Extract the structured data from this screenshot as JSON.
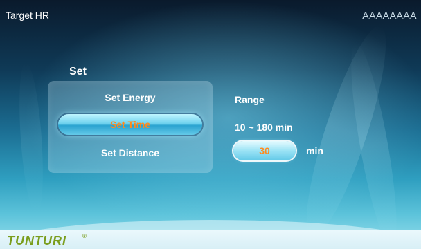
{
  "header": {
    "title": "Target HR",
    "user_id": "AAAAAAAA"
  },
  "set_panel": {
    "heading": "Set",
    "options": [
      {
        "label": "Set Energy",
        "selected": false
      },
      {
        "label": "Set Time",
        "selected": true
      },
      {
        "label": "Set Distance",
        "selected": false
      }
    ]
  },
  "range": {
    "label": "Range",
    "value": "10 ~ 180 min"
  },
  "input": {
    "value": "30",
    "unit": "min"
  },
  "footer": {
    "brand": "TUNTURI",
    "brand_mark": "®"
  },
  "colors": {
    "accent_orange": "#ff8a1e",
    "brand_green": "#7a9d1d",
    "selected_pill": "#6fd2ee"
  }
}
